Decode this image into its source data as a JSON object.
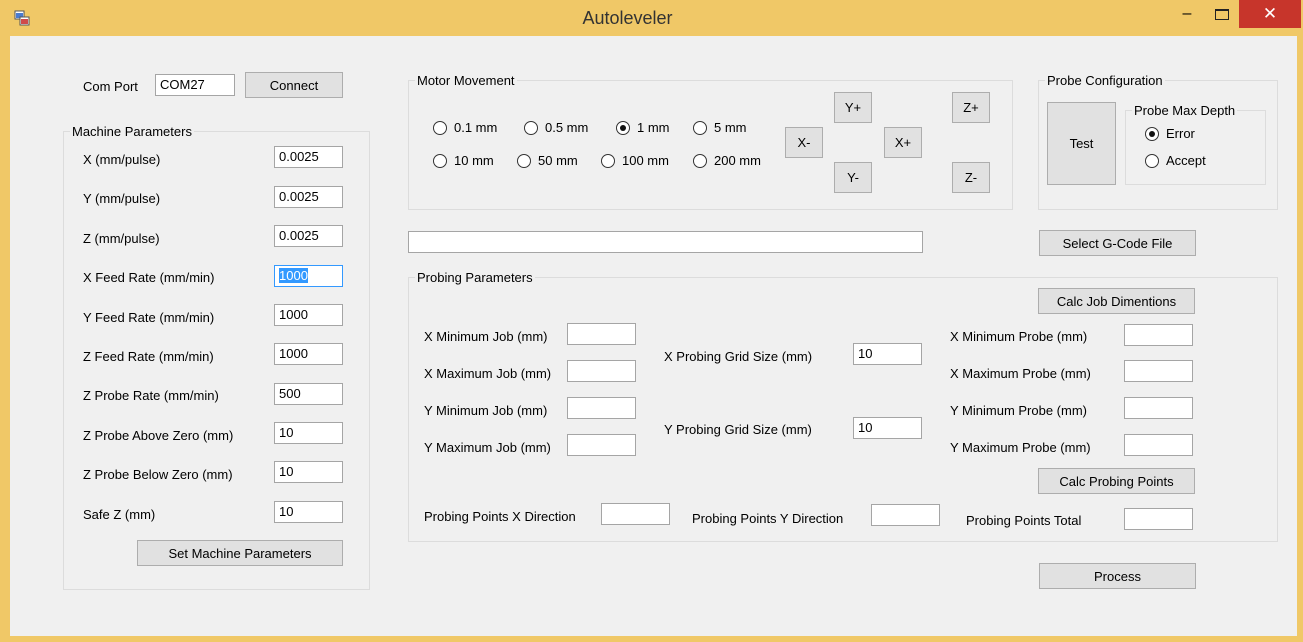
{
  "window": {
    "title": "Autoleveler",
    "minimize": "–",
    "close": "✕"
  },
  "com": {
    "label": "Com Port",
    "value": "COM27",
    "connect": "Connect"
  },
  "machine": {
    "title": "Machine Parameters",
    "rows": [
      {
        "label": "X (mm/pulse)",
        "value": "0.0025"
      },
      {
        "label": "Y (mm/pulse)",
        "value": "0.0025"
      },
      {
        "label": "Z (mm/pulse)",
        "value": "0.0025"
      },
      {
        "label": "X Feed Rate (mm/min)",
        "value": "1000"
      },
      {
        "label": "Y Feed Rate (mm/min)",
        "value": "1000"
      },
      {
        "label": "Z Feed Rate (mm/min)",
        "value": "1000"
      },
      {
        "label": "Z Probe Rate (mm/min)",
        "value": "500"
      },
      {
        "label": "Z Probe Above Zero (mm)",
        "value": "10"
      },
      {
        "label": "Z Probe Below Zero (mm)",
        "value": "10"
      },
      {
        "label": "Safe Z  (mm)",
        "value": "10"
      }
    ],
    "set_button": "Set Machine Parameters"
  },
  "motor": {
    "title": "Motor Movement",
    "steps": [
      "0.1 mm",
      "0.5 mm",
      "1 mm",
      "5 mm",
      "10 mm",
      "50 mm",
      "100 mm",
      "200 mm"
    ],
    "selected": "1 mm",
    "buttons": {
      "yplus": "Y+",
      "yminus": "Y-",
      "xminus": "X-",
      "xplus": "X+",
      "zplus": "Z+",
      "zminus": "Z-"
    }
  },
  "probe_config": {
    "title": "Probe Configuration",
    "test_button": "Test",
    "depth_title": "Probe Max Depth",
    "options": [
      "Error",
      "Accept"
    ],
    "selected": "Error"
  },
  "gcode": {
    "path": "",
    "select_button": "Select G-Code File"
  },
  "probing": {
    "title": "Probing Parameters",
    "calc_job": "Calc Job Dimentions",
    "job": [
      {
        "label": "X Minimum Job (mm)",
        "value": ""
      },
      {
        "label": "X Maximum Job (mm)",
        "value": ""
      },
      {
        "label": "Y Minimum Job (mm)",
        "value": ""
      },
      {
        "label": "Y Maximum Job (mm)",
        "value": ""
      }
    ],
    "grid": [
      {
        "label": "X Probing Grid Size (mm)",
        "value": "10"
      },
      {
        "label": "Y Probing Grid Size (mm)",
        "value": "10"
      }
    ],
    "probe": [
      {
        "label": "X Minimum Probe (mm)",
        "value": ""
      },
      {
        "label": "X Maximum Probe (mm)",
        "value": ""
      },
      {
        "label": "Y Minimum Probe (mm)",
        "value": ""
      },
      {
        "label": "Y Maximum Probe (mm)",
        "value": ""
      }
    ],
    "calc_points": "Calc Probing Points",
    "points_x_label": "Probing Points X Direction",
    "points_x_value": "",
    "points_y_label": "Probing Points Y Direction",
    "points_y_value": "",
    "points_total_label": "Probing Points Total",
    "points_total_value": ""
  },
  "process_button": "Process"
}
